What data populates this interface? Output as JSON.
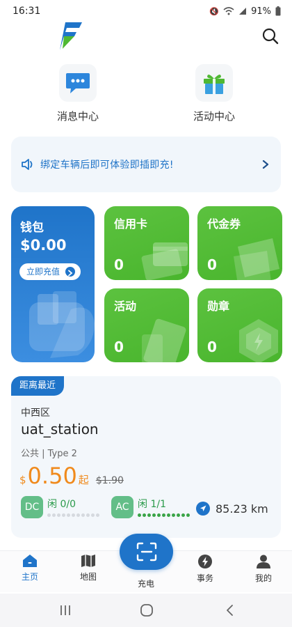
{
  "status_bar": {
    "time": "16:31",
    "battery": "91%"
  },
  "header": {
    "logo_icon": "bolt-f-logo",
    "search_icon": "search-icon"
  },
  "quick_actions": [
    {
      "label": "消息中心",
      "icon": "chat-bubble-icon"
    },
    {
      "label": "活动中心",
      "icon": "gift-icon"
    }
  ],
  "notice": {
    "text": "绑定车辆后即可体验即插即充!",
    "icon": "speaker-icon"
  },
  "wallet": {
    "title": "钱包",
    "amount": "$0.00",
    "button_label": "立即充值"
  },
  "tiles": {
    "credit_card": {
      "title": "信用卡",
      "value": "0"
    },
    "voucher": {
      "title": "代金券",
      "value": "0"
    },
    "activity": {
      "title": "活动",
      "value": "0"
    },
    "badge": {
      "title": "勋章",
      "value": "0"
    }
  },
  "station": {
    "tag": "距离最近",
    "district": "中西区",
    "name": "uat_station",
    "info": "公共 | Type 2",
    "currency": "$",
    "price": "0.50",
    "price_unit": "起",
    "original_price": "$1.90",
    "dc": {
      "label": "DC",
      "status": "闲",
      "count": "0/0",
      "available": 0,
      "total": 0
    },
    "ac": {
      "label": "AC",
      "status": "闲",
      "count": "1/1",
      "available": 1,
      "total": 1
    },
    "distance": "85.23 km"
  },
  "bottom_nav": {
    "home": "主页",
    "map": "地图",
    "charge": "充电",
    "service": "事务",
    "mine": "我的"
  },
  "colors": {
    "primary": "#1f74c9",
    "green": "#4fb833",
    "price": "#f08a1c"
  }
}
